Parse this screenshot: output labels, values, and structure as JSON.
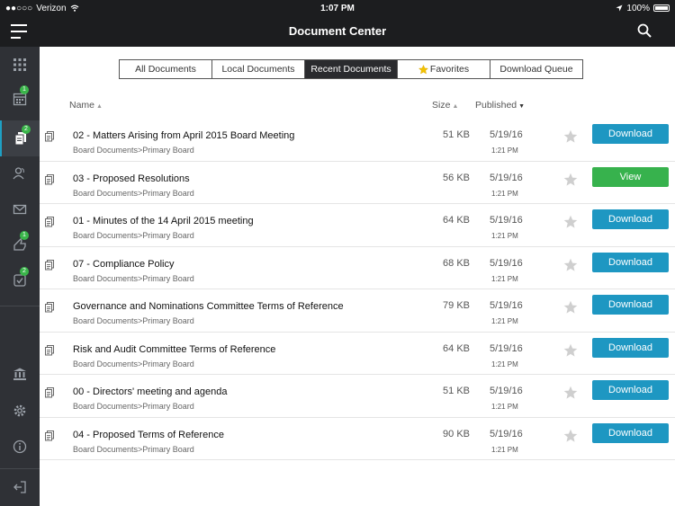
{
  "status_bar": {
    "signal": "●●○○○",
    "carrier": "Verizon",
    "time": "1:07 PM",
    "battery": "100%"
  },
  "header": {
    "title": "Document Center"
  },
  "sidebar": {
    "items": [
      {
        "icon": "grid-icon",
        "badge": ""
      },
      {
        "icon": "calendar-icon",
        "badge": "1"
      },
      {
        "icon": "documents-icon",
        "badge": "2",
        "active": true
      },
      {
        "icon": "people-icon",
        "badge": ""
      },
      {
        "icon": "mail-icon",
        "badge": ""
      },
      {
        "icon": "approval-icon",
        "badge": "1"
      },
      {
        "icon": "checklist-icon",
        "badge": "2"
      },
      {
        "icon": "bank-icon",
        "badge": ""
      },
      {
        "icon": "settings-icon",
        "badge": ""
      },
      {
        "icon": "info-icon",
        "badge": ""
      },
      {
        "icon": "logout-icon",
        "badge": ""
      }
    ]
  },
  "tabs": {
    "all": "All Documents",
    "local": "Local Documents",
    "recent": "Recent Documents",
    "favorites": "Favorites",
    "queue": "Download Queue"
  },
  "columns": {
    "name": "Name",
    "size": "Size",
    "published": "Published"
  },
  "colors": {
    "download": "#1e97c2",
    "view": "#37b24d",
    "accent": "#1ea0c4"
  },
  "documents": [
    {
      "title": "02 - Matters Arising from April 2015 Board Meeting",
      "path": "Board Documents>Primary Board",
      "size": "51 KB",
      "date": "5/19/16",
      "time": "1:21 PM",
      "action": "Download"
    },
    {
      "title": "03 - Proposed Resolutions",
      "path": "Board Documents>Primary Board",
      "size": "56 KB",
      "date": "5/19/16",
      "time": "1:21 PM",
      "action": "View"
    },
    {
      "title": "01 - Minutes of the 14 April 2015 meeting",
      "path": "Board Documents>Primary Board",
      "size": "64 KB",
      "date": "5/19/16",
      "time": "1:21 PM",
      "action": "Download"
    },
    {
      "title": "07 - Compliance Policy",
      "path": "Board Documents>Primary Board",
      "size": "68 KB",
      "date": "5/19/16",
      "time": "1:21 PM",
      "action": "Download"
    },
    {
      "title": "Governance and Nominations Committee Terms of Reference",
      "path": "Board Documents>Primary Board",
      "size": "79 KB",
      "date": "5/19/16",
      "time": "1:21 PM",
      "action": "Download"
    },
    {
      "title": "Risk and Audit Committee Terms of Reference",
      "path": "Board Documents>Primary Board",
      "size": "64 KB",
      "date": "5/19/16",
      "time": "1:21 PM",
      "action": "Download"
    },
    {
      "title": "00 - Directors' meeting and agenda",
      "path": "Board Documents>Primary Board",
      "size": "51 KB",
      "date": "5/19/16",
      "time": "1:21 PM",
      "action": "Download"
    },
    {
      "title": "04 - Proposed Terms of Reference",
      "path": "Board Documents>Primary Board",
      "size": "90 KB",
      "date": "5/19/16",
      "time": "1:21 PM",
      "action": "Download"
    }
  ]
}
